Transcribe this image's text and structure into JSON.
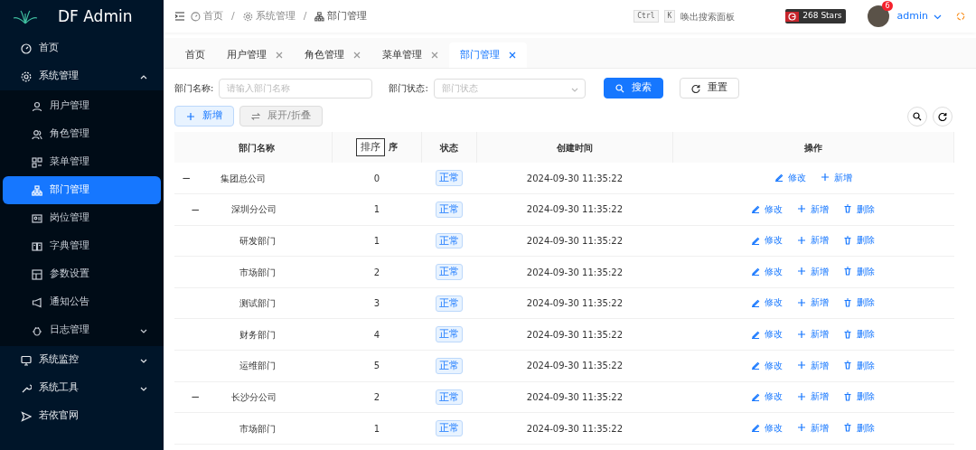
{
  "app": {
    "title": "DF Admin"
  },
  "sidebar": {
    "items": [
      {
        "label": "首页",
        "selected": false
      },
      {
        "label": "系统管理",
        "selected": false,
        "expanded": true,
        "children": [
          {
            "label": "用户管理",
            "selected": false
          },
          {
            "label": "角色管理",
            "selected": false
          },
          {
            "label": "菜单管理",
            "selected": false
          },
          {
            "label": "部门管理",
            "selected": true
          },
          {
            "label": "岗位管理",
            "selected": false
          },
          {
            "label": "字典管理",
            "selected": false
          },
          {
            "label": "参数设置",
            "selected": false
          },
          {
            "label": "通知公告",
            "selected": false
          },
          {
            "label": "日志管理",
            "selected": false,
            "expanded": false
          }
        ]
      },
      {
        "label": "系统监控",
        "selected": false,
        "expanded": false
      },
      {
        "label": "系统工具",
        "selected": false,
        "expanded": false
      },
      {
        "label": "若依官网",
        "selected": false
      }
    ]
  },
  "breadcrumb": [
    "首页",
    "系统管理",
    "部门管理"
  ],
  "breadcrumb_separator": "/",
  "header": {
    "keys": [
      "Ctrl",
      "K"
    ],
    "search_hint": "唤出搜索面板",
    "stars": "268 Stars",
    "notifications": "6",
    "user": "admin"
  },
  "tabs": [
    {
      "label": "首页",
      "selected": false,
      "closable": false
    },
    {
      "label": "用户管理",
      "selected": false,
      "closable": true
    },
    {
      "label": "角色管理",
      "selected": false,
      "closable": true
    },
    {
      "label": "菜单管理",
      "selected": false,
      "closable": true
    },
    {
      "label": "部门管理",
      "selected": true,
      "closable": true
    }
  ],
  "filters": [
    {
      "kind": "text",
      "label": "部门名称:",
      "placeholder": "请输入部门名称"
    },
    {
      "kind": "select",
      "label": "部门状态:",
      "placeholder": "部门状态"
    }
  ],
  "filter_buttons": [
    {
      "kind": "search",
      "label": "搜索"
    },
    {
      "kind": "reset",
      "label": "重置"
    }
  ],
  "toolbar": [
    {
      "kind": "add",
      "label": "新增"
    },
    {
      "kind": "toggle",
      "label": "展开/折叠"
    }
  ],
  "table": {
    "columns": [
      "部门名称",
      "序",
      "状态",
      "创建时间",
      "操作"
    ],
    "tooltip": "排序",
    "expand_symbol": "−",
    "rows": [
      {
        "name": "集团总公司",
        "sort": "0",
        "status": "正常",
        "created": "2024-09-30 11:35:22",
        "expanded": true,
        "actions": [
          {
            "kind": "edit",
            "label": "修改"
          },
          {
            "kind": "add",
            "label": "新增"
          }
        ],
        "children": [
          {
            "name": "深圳分公司",
            "sort": "1",
            "status": "正常",
            "created": "2024-09-30 11:35:22",
            "expanded": true,
            "actions": [
              {
                "kind": "edit",
                "label": "修改"
              },
              {
                "kind": "add",
                "label": "新增"
              },
              {
                "kind": "delete",
                "label": "删除"
              }
            ],
            "children": [
              {
                "name": "研发部门",
                "sort": "1",
                "status": "正常",
                "created": "2024-09-30 11:35:22",
                "actions": [
                  {
                    "kind": "edit",
                    "label": "修改"
                  },
                  {
                    "kind": "add",
                    "label": "新增"
                  },
                  {
                    "kind": "delete",
                    "label": "删除"
                  }
                ]
              },
              {
                "name": "市场部门",
                "sort": "2",
                "status": "正常",
                "created": "2024-09-30 11:35:22",
                "actions": [
                  {
                    "kind": "edit",
                    "label": "修改"
                  },
                  {
                    "kind": "add",
                    "label": "新增"
                  },
                  {
                    "kind": "delete",
                    "label": "删除"
                  }
                ]
              },
              {
                "name": "测试部门",
                "sort": "3",
                "status": "正常",
                "created": "2024-09-30 11:35:22",
                "actions": [
                  {
                    "kind": "edit",
                    "label": "修改"
                  },
                  {
                    "kind": "add",
                    "label": "新增"
                  },
                  {
                    "kind": "delete",
                    "label": "删除"
                  }
                ]
              },
              {
                "name": "财务部门",
                "sort": "4",
                "status": "正常",
                "created": "2024-09-30 11:35:22",
                "actions": [
                  {
                    "kind": "edit",
                    "label": "修改"
                  },
                  {
                    "kind": "add",
                    "label": "新增"
                  },
                  {
                    "kind": "delete",
                    "label": "删除"
                  }
                ]
              },
              {
                "name": "运维部门",
                "sort": "5",
                "status": "正常",
                "created": "2024-09-30 11:35:22",
                "actions": [
                  {
                    "kind": "edit",
                    "label": "修改"
                  },
                  {
                    "kind": "add",
                    "label": "新增"
                  },
                  {
                    "kind": "delete",
                    "label": "删除"
                  }
                ]
              }
            ]
          },
          {
            "name": "长沙分公司",
            "sort": "2",
            "status": "正常",
            "created": "2024-09-30 11:35:22",
            "expanded": true,
            "actions": [
              {
                "kind": "edit",
                "label": "修改"
              },
              {
                "kind": "add",
                "label": "新增"
              },
              {
                "kind": "delete",
                "label": "删除"
              }
            ],
            "children": [
              {
                "name": "市场部门",
                "sort": "1",
                "status": "正常",
                "created": "2024-09-30 11:35:22",
                "actions": [
                  {
                    "kind": "edit",
                    "label": "修改"
                  },
                  {
                    "kind": "add",
                    "label": "新增"
                  },
                  {
                    "kind": "delete",
                    "label": "删除"
                  }
                ]
              }
            ]
          }
        ]
      }
    ]
  }
}
